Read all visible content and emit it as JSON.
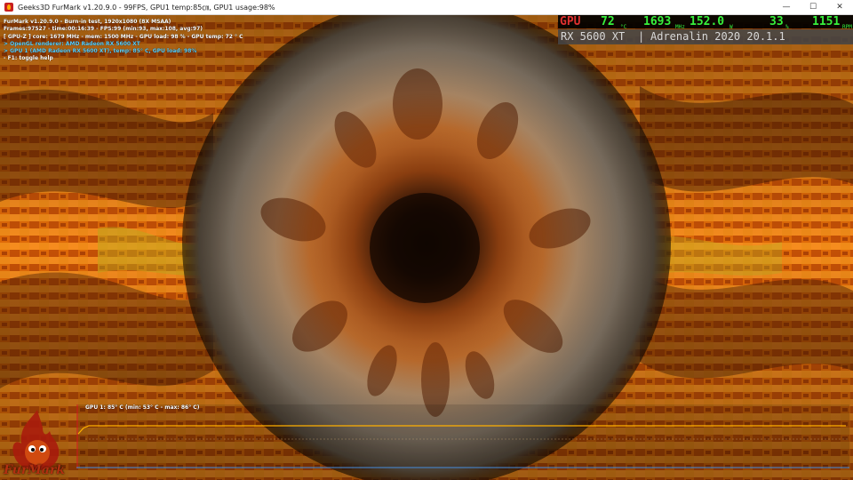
{
  "window": {
    "title": "Geeks3D FurMark v1.20.9.0 - 99FPS, GPU1 temp:85㎝, GPU1 usage:98%",
    "minimize_glyph": "—",
    "maximize_glyph": "☐",
    "close_glyph": "✕"
  },
  "overlay": {
    "lines": [
      "FurMark v1.20.9.0 - Burn-in test, 1920x1080 (8X MSAA)",
      "Frames:97527 - time:00:16:39 - FPS:99 (min:93, max:108, avg:97)",
      "[ GPU-Z ] core: 1679 MHz - mem: 1500 MHz - GPU load: 98 % - GPU temp: 72 ° C",
      "> OpenGL renderer: AMD Radeon RX 5600 XT",
      "> GPU 1 (AMD Radeon RX 5600 XT), temp: 85° C, GPU load: 98%",
      "- F1: toggle help"
    ]
  },
  "osd": {
    "gpu_label": "GPU",
    "temp": "72",
    "temp_unit": "°C",
    "clock": "1693",
    "clock_unit": "MHz",
    "power": "152.0",
    "power_unit": "W",
    "fan": "33",
    "fan_unit": "%",
    "rpm": "1151",
    "rpm_unit": "RPM",
    "gpu_name": "RX 5600 XT",
    "separator": "|",
    "driver": "Adrenalin 2020 20.1.1"
  },
  "graph": {
    "label": "GPU 1: 85° C (min: 53° C - max: 86° C)",
    "line_color": "#ffb000",
    "min_temp": 53,
    "max_temp": 86,
    "current_temp": 85
  },
  "logo": {
    "text": "FurMark"
  },
  "colors": {
    "osd_green": "#37f03c",
    "osd_red": "#e03030",
    "overlay_cyan": "#5ad0ff"
  }
}
